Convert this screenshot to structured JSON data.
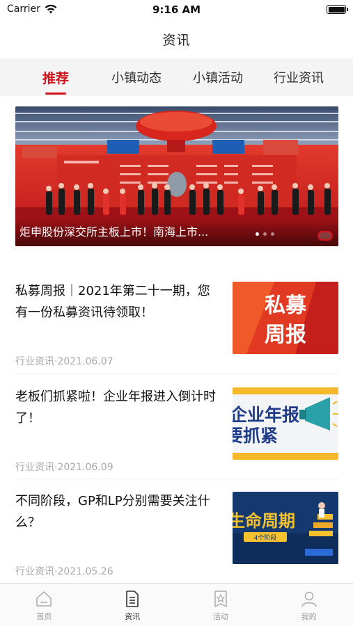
{
  "status_bar": {
    "carrier": "Carrier",
    "time": "9:16 AM"
  },
  "nav": {
    "title": "资讯"
  },
  "tabs": [
    {
      "label": "推荐",
      "active": true
    },
    {
      "label": "小镇动态"
    },
    {
      "label": "小镇活动"
    },
    {
      "label": "行业资讯"
    }
  ],
  "banner": {
    "title": "炬申股份深交所主板上市！南海上市...",
    "slides": 3,
    "active_slide": 1
  },
  "articles": [
    {
      "title": "私募周报｜2021年第二十一期，您有一份私募资讯待领取！",
      "meta": "行业资讯·2021.06.07",
      "thumb_text": "私募周报"
    },
    {
      "title": "老板们抓紧啦！企业年报进入倒计时了！",
      "meta": "行业资讯·2021.06.09",
      "thumb_text": "企业年报 要抓紧"
    },
    {
      "title": "不同阶段，GP和LP分别需要关注什么？",
      "meta": "行业资讯·2021.05.26",
      "thumb_text": "生命周期",
      "thumb_sub": "4个阶段"
    }
  ],
  "tab_bar": [
    {
      "label": "首页",
      "icon": "home-icon"
    },
    {
      "label": "资讯",
      "icon": "document-icon",
      "active": true
    },
    {
      "label": "活动",
      "icon": "activity-icon"
    },
    {
      "label": "我的",
      "icon": "user-icon"
    }
  ],
  "colors": {
    "accent": "#d0121b",
    "tab_bg": "#f4f4f4",
    "meta": "#a8a8a8"
  }
}
